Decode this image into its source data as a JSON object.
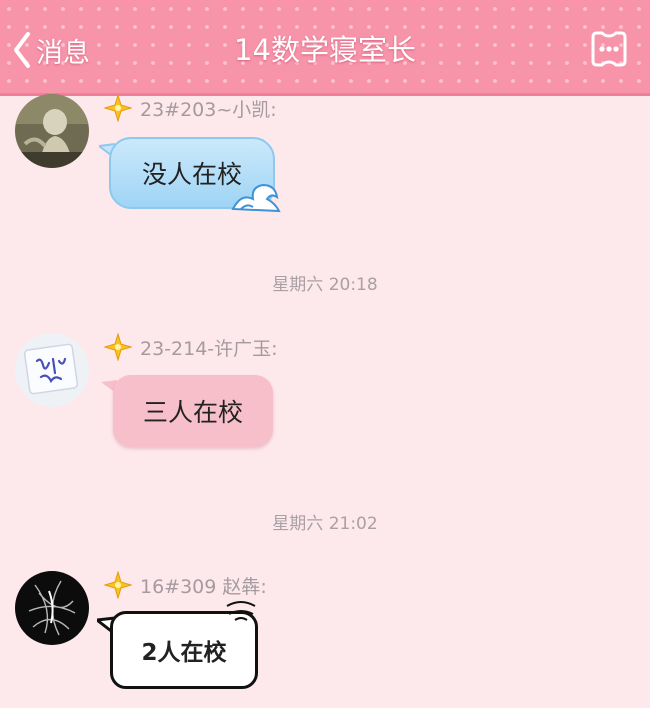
{
  "header": {
    "back_label": "消息",
    "title": "14数学寝室长",
    "background_color": "#f794aa"
  },
  "messages": [
    {
      "sender": "23#203~小凯:",
      "text": "没人在校",
      "bubble_style": "blue-wave"
    },
    {
      "sender": "23-214-许广玉:",
      "text": "三人在校",
      "bubble_style": "pink"
    },
    {
      "sender": "16#309 赵犇:",
      "text": "2人在校",
      "bubble_style": "white-comic"
    }
  ],
  "timestamps": [
    {
      "text": "星期六 20:18"
    },
    {
      "text": "星期六 21:02"
    }
  ]
}
